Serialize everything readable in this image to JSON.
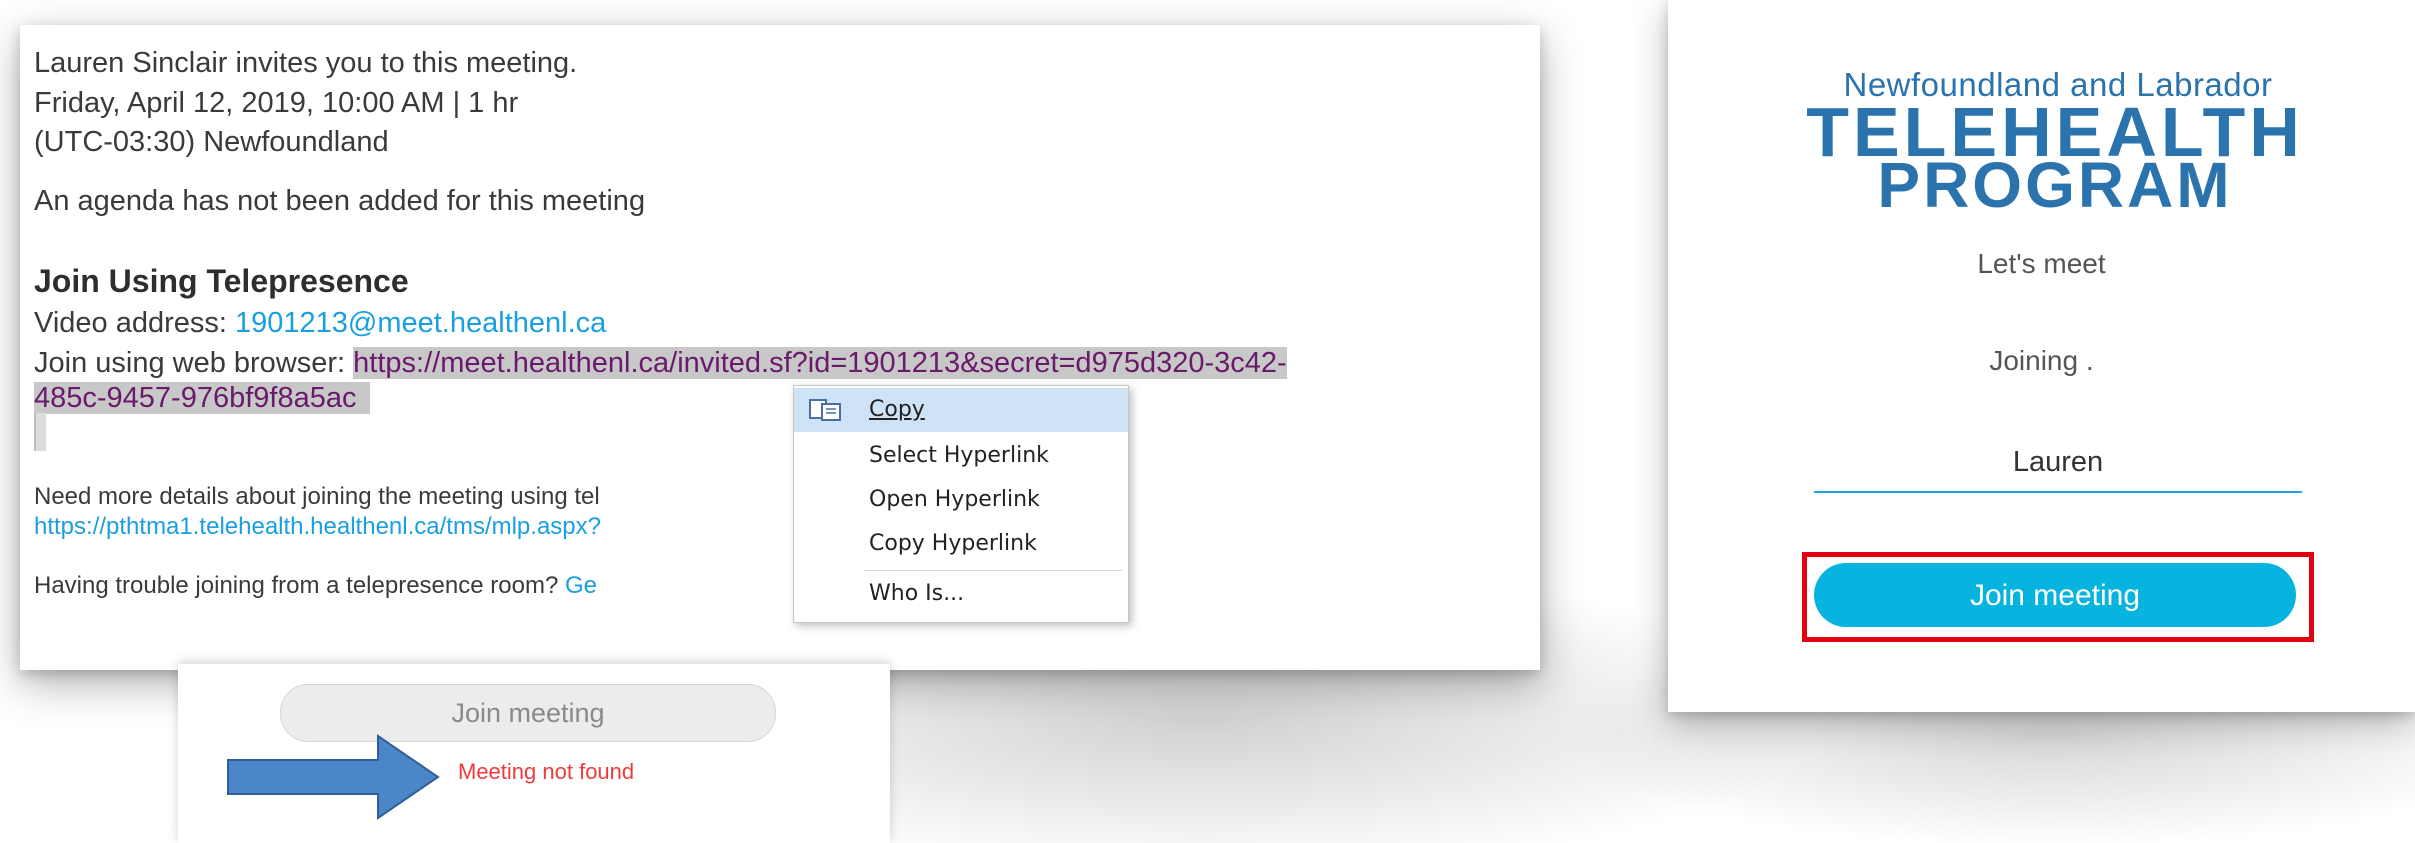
{
  "colors": {
    "link_blue": "#1a9fe0",
    "visited_purple": "#6a1a6b",
    "telehealth_blue": "#2a73ad",
    "join_button": "#07b4e0",
    "highlight_frame": "#e3000f",
    "error_red": "#ef3b3b"
  },
  "email": {
    "invite_line": "Lauren Sinclair invites you to this meeting.",
    "date_line": "Friday, April 12, 2019, 10:00 AM | 1 hr",
    "timezone_line": "(UTC-03:30) Newfoundland",
    "agenda_line": "An agenda has not been added for this meeting",
    "join_heading": "Join Using Telepresence",
    "video_label": "Video address: ",
    "video_address": "1901213@meet.healthenl.ca",
    "web_label": "Join using web browser: ",
    "web_url_part1": "https://meet.healthenl.ca",
    "web_url_part_hidden": "/invited.sf?id=1901213",
    "web_url_part2": "&secret=d975d320-3c42-",
    "web_url_line2": "485c-9457-976bf9f8a5ac",
    "details_text": "Need more details about joining the meeting using tel",
    "details_url": "https://pthtma1.telehealth.healthenl.ca/tms/mlp.aspx?",
    "trouble_text": "Having trouble joining from a telepresence room? ",
    "trouble_link": "Ge"
  },
  "context_menu": {
    "items": [
      {
        "label": "Copy",
        "icon": "copy-icon"
      },
      {
        "label": "Select Hyperlink"
      },
      {
        "label": "Open Hyperlink"
      },
      {
        "label": "Copy Hyperlink"
      },
      {
        "label": "Who Is..."
      }
    ]
  },
  "error_panel": {
    "button_label": "Join meeting",
    "message": "Meeting not found",
    "arrow_icon": "right-arrow-icon"
  },
  "telehealth": {
    "logo_line1": "Newfoundland and Labrador",
    "logo_line2": "TELEHEALTH",
    "logo_line3": "PROGRAM",
    "lets_meet": "Let's meet",
    "joining": "Joining .",
    "name_value": "Lauren",
    "join_button": "Join meeting"
  }
}
